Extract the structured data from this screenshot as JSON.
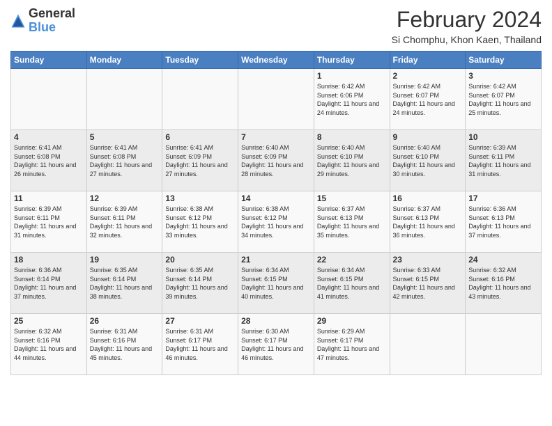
{
  "logo": {
    "text_general": "General",
    "text_blue": "Blue"
  },
  "header": {
    "month_year": "February 2024",
    "location": "Si Chomphu, Khon Kaen, Thailand"
  },
  "days_of_week": [
    "Sunday",
    "Monday",
    "Tuesday",
    "Wednesday",
    "Thursday",
    "Friday",
    "Saturday"
  ],
  "weeks": [
    [
      {
        "day": "",
        "info": ""
      },
      {
        "day": "",
        "info": ""
      },
      {
        "day": "",
        "info": ""
      },
      {
        "day": "",
        "info": ""
      },
      {
        "day": "1",
        "info": "Sunrise: 6:42 AM\nSunset: 6:06 PM\nDaylight: 11 hours and 24 minutes."
      },
      {
        "day": "2",
        "info": "Sunrise: 6:42 AM\nSunset: 6:07 PM\nDaylight: 11 hours and 24 minutes."
      },
      {
        "day": "3",
        "info": "Sunrise: 6:42 AM\nSunset: 6:07 PM\nDaylight: 11 hours and 25 minutes."
      }
    ],
    [
      {
        "day": "4",
        "info": "Sunrise: 6:41 AM\nSunset: 6:08 PM\nDaylight: 11 hours and 26 minutes."
      },
      {
        "day": "5",
        "info": "Sunrise: 6:41 AM\nSunset: 6:08 PM\nDaylight: 11 hours and 27 minutes."
      },
      {
        "day": "6",
        "info": "Sunrise: 6:41 AM\nSunset: 6:09 PM\nDaylight: 11 hours and 27 minutes."
      },
      {
        "day": "7",
        "info": "Sunrise: 6:40 AM\nSunset: 6:09 PM\nDaylight: 11 hours and 28 minutes."
      },
      {
        "day": "8",
        "info": "Sunrise: 6:40 AM\nSunset: 6:10 PM\nDaylight: 11 hours and 29 minutes."
      },
      {
        "day": "9",
        "info": "Sunrise: 6:40 AM\nSunset: 6:10 PM\nDaylight: 11 hours and 30 minutes."
      },
      {
        "day": "10",
        "info": "Sunrise: 6:39 AM\nSunset: 6:11 PM\nDaylight: 11 hours and 31 minutes."
      }
    ],
    [
      {
        "day": "11",
        "info": "Sunrise: 6:39 AM\nSunset: 6:11 PM\nDaylight: 11 hours and 31 minutes."
      },
      {
        "day": "12",
        "info": "Sunrise: 6:39 AM\nSunset: 6:11 PM\nDaylight: 11 hours and 32 minutes."
      },
      {
        "day": "13",
        "info": "Sunrise: 6:38 AM\nSunset: 6:12 PM\nDaylight: 11 hours and 33 minutes."
      },
      {
        "day": "14",
        "info": "Sunrise: 6:38 AM\nSunset: 6:12 PM\nDaylight: 11 hours and 34 minutes."
      },
      {
        "day": "15",
        "info": "Sunrise: 6:37 AM\nSunset: 6:13 PM\nDaylight: 11 hours and 35 minutes."
      },
      {
        "day": "16",
        "info": "Sunrise: 6:37 AM\nSunset: 6:13 PM\nDaylight: 11 hours and 36 minutes."
      },
      {
        "day": "17",
        "info": "Sunrise: 6:36 AM\nSunset: 6:13 PM\nDaylight: 11 hours and 37 minutes."
      }
    ],
    [
      {
        "day": "18",
        "info": "Sunrise: 6:36 AM\nSunset: 6:14 PM\nDaylight: 11 hours and 37 minutes."
      },
      {
        "day": "19",
        "info": "Sunrise: 6:35 AM\nSunset: 6:14 PM\nDaylight: 11 hours and 38 minutes."
      },
      {
        "day": "20",
        "info": "Sunrise: 6:35 AM\nSunset: 6:14 PM\nDaylight: 11 hours and 39 minutes."
      },
      {
        "day": "21",
        "info": "Sunrise: 6:34 AM\nSunset: 6:15 PM\nDaylight: 11 hours and 40 minutes."
      },
      {
        "day": "22",
        "info": "Sunrise: 6:34 AM\nSunset: 6:15 PM\nDaylight: 11 hours and 41 minutes."
      },
      {
        "day": "23",
        "info": "Sunrise: 6:33 AM\nSunset: 6:15 PM\nDaylight: 11 hours and 42 minutes."
      },
      {
        "day": "24",
        "info": "Sunrise: 6:32 AM\nSunset: 6:16 PM\nDaylight: 11 hours and 43 minutes."
      }
    ],
    [
      {
        "day": "25",
        "info": "Sunrise: 6:32 AM\nSunset: 6:16 PM\nDaylight: 11 hours and 44 minutes."
      },
      {
        "day": "26",
        "info": "Sunrise: 6:31 AM\nSunset: 6:16 PM\nDaylight: 11 hours and 45 minutes."
      },
      {
        "day": "27",
        "info": "Sunrise: 6:31 AM\nSunset: 6:17 PM\nDaylight: 11 hours and 46 minutes."
      },
      {
        "day": "28",
        "info": "Sunrise: 6:30 AM\nSunset: 6:17 PM\nDaylight: 11 hours and 46 minutes."
      },
      {
        "day": "29",
        "info": "Sunrise: 6:29 AM\nSunset: 6:17 PM\nDaylight: 11 hours and 47 minutes."
      },
      {
        "day": "",
        "info": ""
      },
      {
        "day": "",
        "info": ""
      }
    ]
  ]
}
